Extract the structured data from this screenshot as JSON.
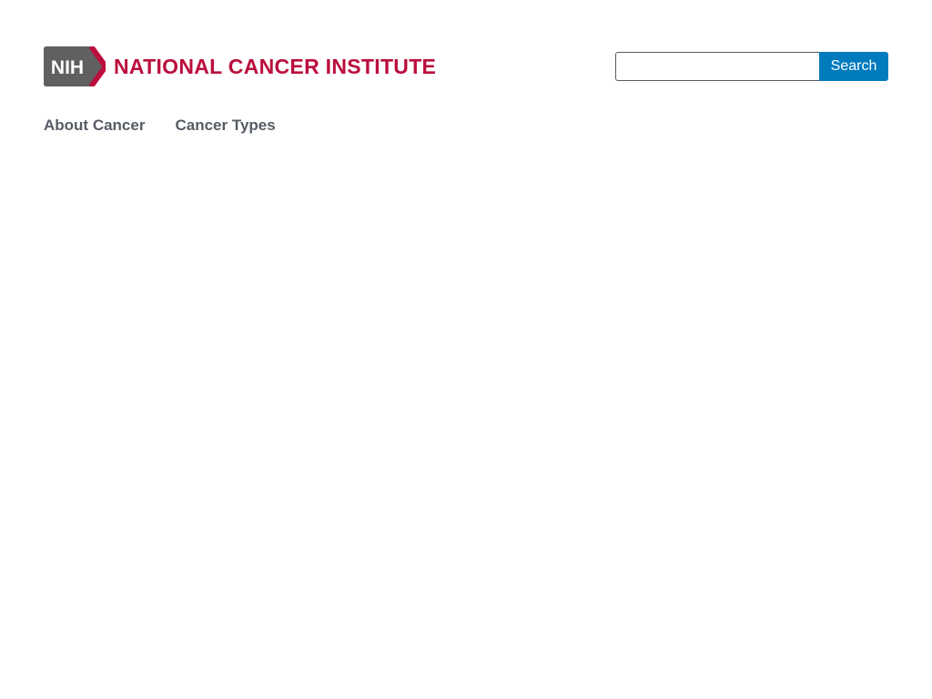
{
  "header": {
    "logo_text": "NIH",
    "org_name": "NATIONAL CANCER INSTITUTE"
  },
  "search": {
    "value": "",
    "placeholder": "",
    "button_label": "Search"
  },
  "nav": {
    "items": [
      {
        "label": "About Cancer"
      },
      {
        "label": "Cancer Types"
      }
    ]
  },
  "colors": {
    "brand_red": "#bb0e3d",
    "nih_gray": "#606060",
    "accent_blue": "#007bbd",
    "nav_text": "#565c65"
  },
  "icons": {
    "logo": "nih-logo-icon"
  }
}
